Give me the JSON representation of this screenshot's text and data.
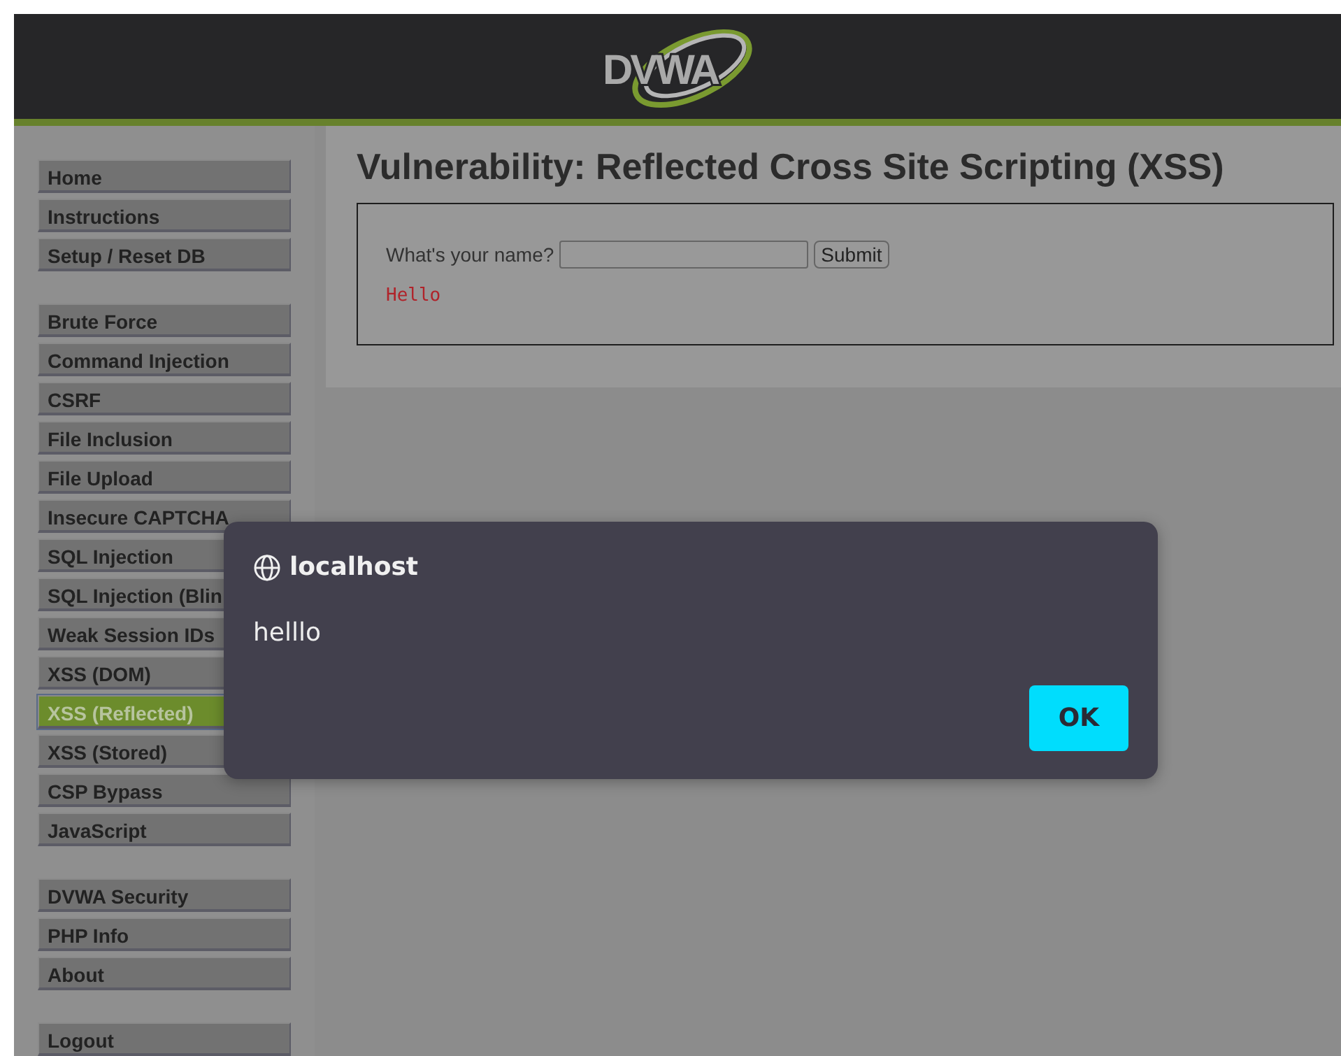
{
  "header": {
    "logo": "DVWA"
  },
  "menu_groups": [
    {
      "items": [
        {
          "label": "Home",
          "selected": false
        },
        {
          "label": "Instructions",
          "selected": false
        },
        {
          "label": "Setup / Reset DB",
          "selected": false
        }
      ]
    },
    {
      "items": [
        {
          "label": "Brute Force",
          "selected": false
        },
        {
          "label": "Command Injection",
          "selected": false
        },
        {
          "label": "CSRF",
          "selected": false
        },
        {
          "label": "File Inclusion",
          "selected": false
        },
        {
          "label": "File Upload",
          "selected": false
        },
        {
          "label": "Insecure CAPTCHA",
          "selected": false
        },
        {
          "label": "SQL Injection",
          "selected": false
        },
        {
          "label": "SQL Injection (Blin",
          "selected": false
        },
        {
          "label": "Weak Session IDs",
          "selected": false
        },
        {
          "label": "XSS (DOM)",
          "selected": false
        },
        {
          "label": "XSS (Reflected)",
          "selected": true
        },
        {
          "label": "XSS (Stored)",
          "selected": false
        },
        {
          "label": "CSP Bypass",
          "selected": false
        },
        {
          "label": "JavaScript",
          "selected": false
        }
      ]
    },
    {
      "items": [
        {
          "label": "DVWA Security",
          "selected": false
        },
        {
          "label": "PHP Info",
          "selected": false
        },
        {
          "label": "About",
          "selected": false
        }
      ]
    },
    {
      "items": [
        {
          "label": "Logout",
          "selected": false
        }
      ]
    }
  ],
  "main": {
    "title": "Vulnerability: Reflected Cross Site Scripting (XSS)",
    "form": {
      "label": "What's your name?",
      "button": "Submit"
    },
    "output": "Hello"
  },
  "dialog": {
    "origin": "localhost",
    "message": "helllo",
    "button": "OK"
  }
}
